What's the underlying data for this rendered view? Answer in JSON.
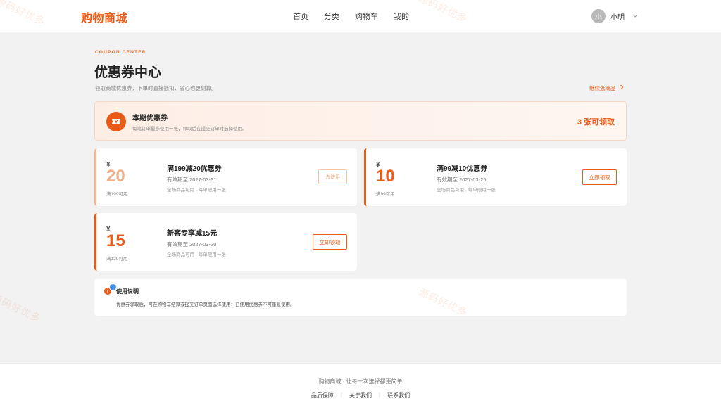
{
  "header": {
    "logo": "购物商城",
    "nav": [
      "首页",
      "分类",
      "购物车",
      "我的"
    ],
    "user": {
      "avatar_text": "小",
      "name": "小明"
    }
  },
  "page": {
    "eyebrow": "COUPON CENTER",
    "title": "优惠券中心",
    "description": "领取商城优惠券，下单时直接抵扣，省心也更划算。",
    "continue_link": "继续逛商品"
  },
  "banner": {
    "title": "本期优惠券",
    "subtitle": "每笔订单最多使用一张，领取后在提交订单时选择使用。",
    "count_text": "3 张可领取"
  },
  "coupons": [
    {
      "currency": "¥",
      "amount": "20",
      "condition": "满199可用",
      "title": "满199减20优惠券",
      "expiry": "有效期至 2027-03-31",
      "note": "全场商品可用 · 每单限用一张",
      "button": "去使用",
      "status": "claimed"
    },
    {
      "currency": "¥",
      "amount": "10",
      "condition": "满99可用",
      "title": "满99减10优惠券",
      "expiry": "有效期至 2027-03-25",
      "note": "全场商品可用 · 每单限用一张",
      "button": "立即领取",
      "status": "available"
    },
    {
      "currency": "¥",
      "amount": "15",
      "condition": "满129可用",
      "title": "新客专享减15元",
      "expiry": "有效期至 2027-03-20",
      "note": "全场商品可用 · 每单限用一张",
      "button": "立即领取",
      "status": "available"
    }
  ],
  "notes": {
    "icon": "info-icon",
    "title": "使用说明",
    "text": "优惠券领取后，可在购物车结算或提交订单页面选择使用；已使用优惠券不可重复使用。"
  },
  "footer": {
    "slogan": "购物商城 · 让每一次选择都更简单",
    "links": [
      "品质保障",
      "关于我们",
      "联系我们"
    ]
  },
  "watermark": "源码好优多",
  "colors": {
    "accent": "#ea5a14",
    "background": "#f2f2f3"
  }
}
